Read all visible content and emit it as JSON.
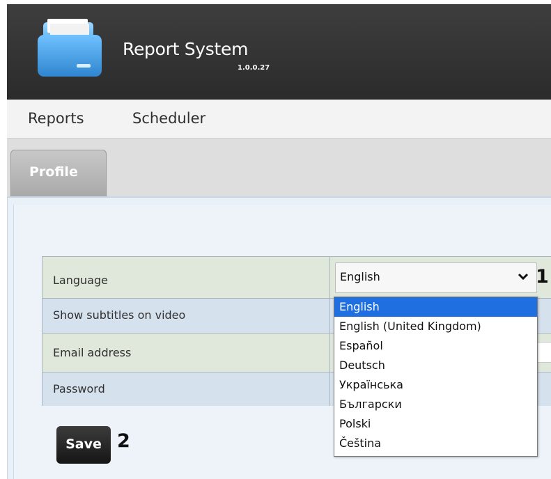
{
  "app": {
    "title": "Report System",
    "version": "1.0.0.27"
  },
  "nav": {
    "reports": "Reports",
    "scheduler": "Scheduler"
  },
  "tabs": {
    "profile": "Profile"
  },
  "form": {
    "rows": [
      {
        "label": "Language"
      },
      {
        "label": "Show subtitles on video"
      },
      {
        "label": "Email address"
      },
      {
        "label": "Password"
      }
    ],
    "language_select": {
      "selected": "English",
      "options": [
        "English",
        "English (United Kingdom)",
        "Español",
        "Deutsch",
        "Українська",
        "Български",
        "Polski",
        "Čeština"
      ]
    },
    "save_label": "Save"
  },
  "callouts": {
    "one": "1",
    "two": "2"
  },
  "icons": {
    "logo": "folder-icon",
    "select_arrow": "chevron-down-icon"
  },
  "colors": {
    "header_bg": "#2f2f2f",
    "highlight": "#1f6fe0",
    "row_green": "#dfe8da",
    "row_blue": "#d6e1ee"
  }
}
